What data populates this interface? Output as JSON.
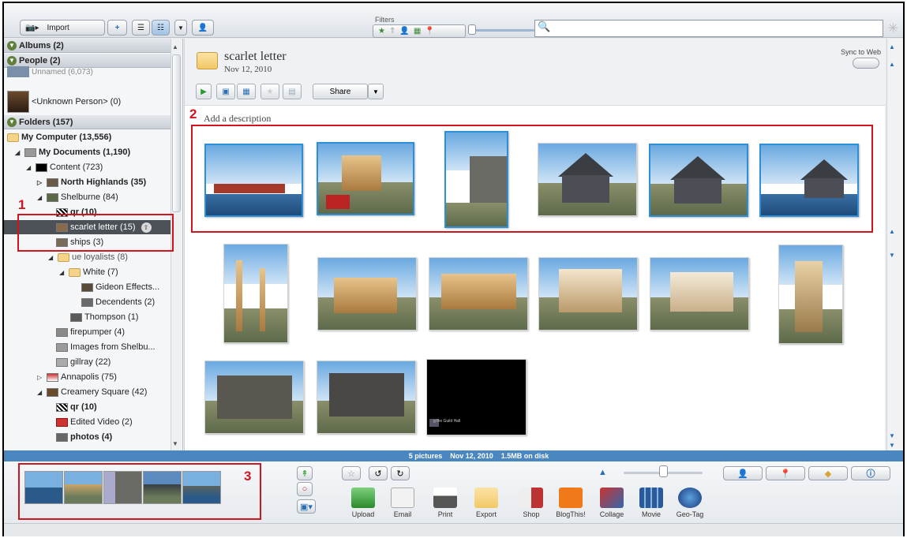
{
  "toolbar": {
    "import_label": "Import",
    "filters_label": "Filters",
    "search_placeholder": ""
  },
  "sidebar": {
    "albums_label": "Albums (2)",
    "people_label": "People (2)",
    "unnamed_label": "Unnamed (6,073)",
    "unknown_person_label": "<Unknown Person> (0)",
    "folders_label": "Folders (157)",
    "items": [
      {
        "label": "My Computer (13,556)"
      },
      {
        "label": "My Documents (1,190)"
      },
      {
        "label": "Content (723)"
      },
      {
        "label": "North Highlands (35)"
      },
      {
        "label": "Shelburne (84)"
      },
      {
        "label": "qr (10)"
      },
      {
        "label": "scarlet letter (15)"
      },
      {
        "label": "ships (3)"
      },
      {
        "label": "ue loyalists (8)"
      },
      {
        "label": "White (7)"
      },
      {
        "label": "Gideon Effects..."
      },
      {
        "label": "Decendents (2)"
      },
      {
        "label": "Thompson (1)"
      },
      {
        "label": "firepumper (4)"
      },
      {
        "label": "Images from Shelbu..."
      },
      {
        "label": "gillray (22)"
      },
      {
        "label": "Annapolis (75)"
      },
      {
        "label": "Creamery Square (42)"
      },
      {
        "label": "qr (10)"
      },
      {
        "label": "Edited Video (2)"
      },
      {
        "label": "photos (4)"
      }
    ]
  },
  "album": {
    "title": "scarlet letter",
    "date": "Nov 12, 2010",
    "sync_label": "Sync to Web",
    "share_label": "Share",
    "description_placeholder": "Add a description",
    "video_caption": "g the Guild Hall"
  },
  "status": {
    "count": "5 pictures",
    "date": "Nov 12, 2010",
    "size": "1.5MB on disk"
  },
  "tray": {
    "tools": [
      {
        "label": "Upload"
      },
      {
        "label": "Email"
      },
      {
        "label": "Print"
      },
      {
        "label": "Export"
      },
      {
        "label": "Shop"
      },
      {
        "label": "BlogThis!"
      },
      {
        "label": "Collage"
      },
      {
        "label": "Movie"
      },
      {
        "label": "Geo-Tag"
      }
    ]
  },
  "annotations": {
    "one": "1",
    "two": "2",
    "three": "3"
  },
  "colors": {
    "selection": "#2e8fd6",
    "annotation": "#d2141e",
    "status_bar": "#4a86c0"
  }
}
